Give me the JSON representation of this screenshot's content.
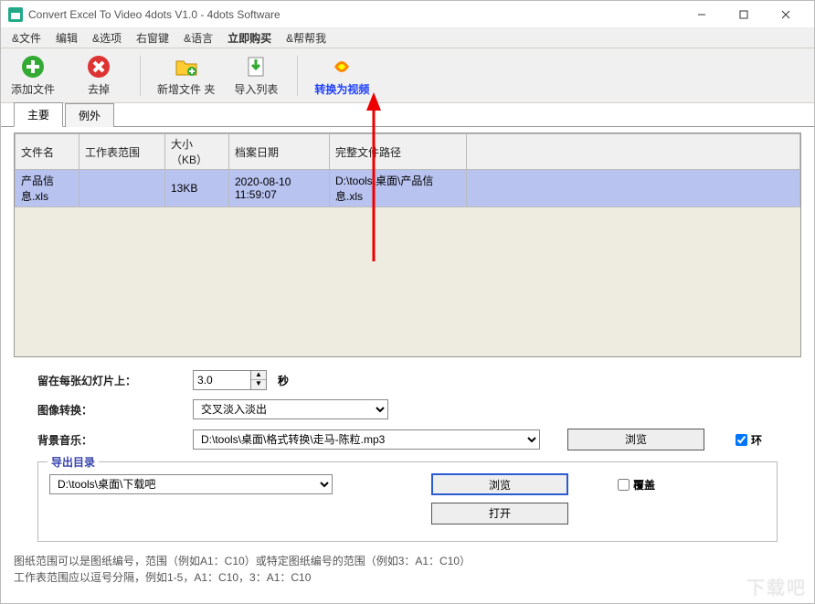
{
  "window": {
    "title": "Convert Excel To Video 4dots V1.0 - 4dots Software"
  },
  "menu": {
    "file": "&文件",
    "edit": "编辑",
    "options": "&选项",
    "rightkey": "右窗键",
    "lang": "&语言",
    "buynow": "立即购买",
    "help": "&帮帮我"
  },
  "toolbar": {
    "add": "添加文件",
    "remove": "去掉",
    "addfolder": "新增文件 夹",
    "importlist": "导入列表",
    "convert": "转换为视频"
  },
  "tabs": {
    "main": "主要",
    "exclude": "例外"
  },
  "columns": {
    "filename": "文件名",
    "sheetrange": "工作表范围",
    "size": "大小（KB）",
    "date": "档案日期",
    "fullpath": "完整文件路径"
  },
  "rows": [
    {
      "filename": "产品信息.xls",
      "sheetrange": "",
      "size": "13KB",
      "date": "2020-08-10 11:59:07",
      "fullpath": "D:\\tools\\桌面\\产品信息.xls"
    }
  ],
  "opts": {
    "stay_label": "留在每张幻灯片上：",
    "stay_value": "3.0",
    "stay_unit": "秒",
    "transition_label": "图像转换：",
    "transition_value": "交叉淡入淡出",
    "bgm_label": "背景音乐：",
    "bgm_value": "D:\\tools\\桌面\\格式转换\\走马-陈粒.mp3",
    "browse": "浏览",
    "loop": "环"
  },
  "export": {
    "legend": "导出目录",
    "path": "D:\\tools\\桌面\\下载吧",
    "browse": "浏览",
    "open": "打开",
    "overwrite": "覆盖"
  },
  "hint": {
    "l1": "图纸范围可以是图纸编号，范围（例如A1：C10）或特定图纸编号的范围（例如3：A1：C10）",
    "l2": "工作表范围应以逗号分隔，例如1-5，A1：C10，3：A1：C10"
  },
  "watermark": "下载吧"
}
